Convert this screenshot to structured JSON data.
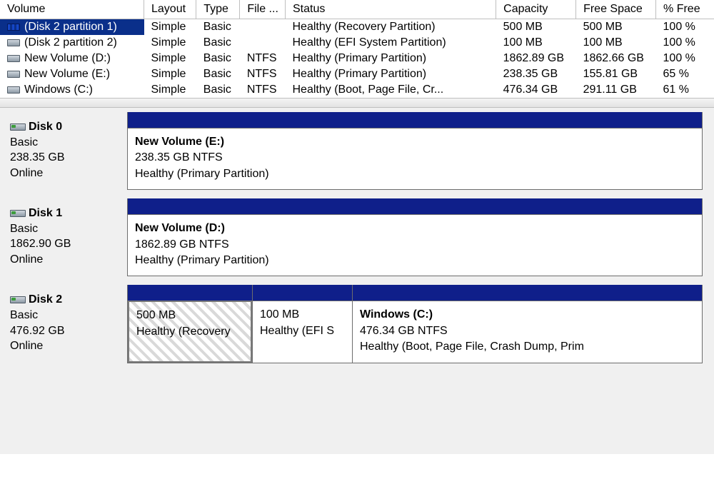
{
  "columns": {
    "volume": "Volume",
    "layout": "Layout",
    "type": "Type",
    "fs": "File ...",
    "status": "Status",
    "capacity": "Capacity",
    "free": "Free Space",
    "pct": "% Free"
  },
  "volumes": [
    {
      "name": "(Disk 2 partition 1)",
      "layout": "Simple",
      "type": "Basic",
      "fs": "",
      "status": "Healthy (Recovery Partition)",
      "capacity": "500 MB",
      "free": "500 MB",
      "pct": "100 %",
      "selected": true
    },
    {
      "name": "(Disk 2 partition 2)",
      "layout": "Simple",
      "type": "Basic",
      "fs": "",
      "status": "Healthy (EFI System Partition)",
      "capacity": "100 MB",
      "free": "100 MB",
      "pct": "100 %",
      "selected": false
    },
    {
      "name": "New Volume (D:)",
      "layout": "Simple",
      "type": "Basic",
      "fs": "NTFS",
      "status": "Healthy (Primary Partition)",
      "capacity": "1862.89 GB",
      "free": "1862.66 GB",
      "pct": "100 %",
      "selected": false
    },
    {
      "name": "New Volume (E:)",
      "layout": "Simple",
      "type": "Basic",
      "fs": "NTFS",
      "status": "Healthy (Primary Partition)",
      "capacity": "238.35 GB",
      "free": "155.81 GB",
      "pct": "65 %",
      "selected": false
    },
    {
      "name": "Windows (C:)",
      "layout": "Simple",
      "type": "Basic",
      "fs": "NTFS",
      "status": "Healthy (Boot, Page File, Cr...",
      "capacity": "476.34 GB",
      "free": "291.11 GB",
      "pct": "61 %",
      "selected": false
    }
  ],
  "disks": [
    {
      "name": "Disk 0",
      "type": "Basic",
      "size": "238.35 GB",
      "state": "Online",
      "parts": [
        {
          "title": "New Volume  (E:)",
          "line2": "238.35 GB NTFS",
          "line3": "Healthy (Primary Partition)",
          "wclass": "w-full",
          "hatched": false
        }
      ]
    },
    {
      "name": "Disk 1",
      "type": "Basic",
      "size": "1862.90 GB",
      "state": "Online",
      "parts": [
        {
          "title": "New Volume  (D:)",
          "line2": "1862.89 GB NTFS",
          "line3": "Healthy (Primary Partition)",
          "wclass": "w-full",
          "hatched": false
        }
      ]
    },
    {
      "name": "Disk 2",
      "type": "Basic",
      "size": "476.92 GB",
      "state": "Online",
      "parts": [
        {
          "title": "",
          "line2": "500 MB",
          "line3": "Healthy (Recovery",
          "wclass": "w-small1",
          "hatched": true
        },
        {
          "title": "",
          "line2": "100 MB",
          "line3": "Healthy (EFI S",
          "wclass": "w-small2",
          "hatched": false
        },
        {
          "title": "Windows  (C:)",
          "line2": "476.34 GB NTFS",
          "line3": "Healthy (Boot, Page File, Crash Dump, Prim",
          "wclass": "w-rest",
          "hatched": false
        }
      ]
    }
  ]
}
